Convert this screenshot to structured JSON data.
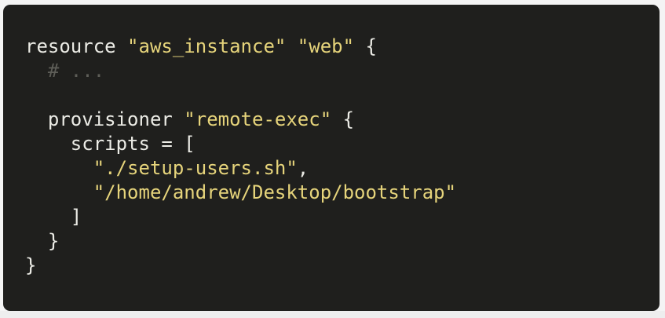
{
  "code_block": {
    "lines": [
      [
        {
          "text": "resource ",
          "kind": "plain"
        },
        {
          "text": "\"aws_instance\"",
          "kind": "string"
        },
        {
          "text": " ",
          "kind": "plain"
        },
        {
          "text": "\"web\"",
          "kind": "string"
        },
        {
          "text": " {",
          "kind": "plain"
        }
      ],
      [
        {
          "text": "  # ...",
          "kind": "comment"
        }
      ],
      [],
      [
        {
          "text": "  provisioner ",
          "kind": "plain"
        },
        {
          "text": "\"remote-exec\"",
          "kind": "string"
        },
        {
          "text": " {",
          "kind": "plain"
        }
      ],
      [
        {
          "text": "    scripts = [",
          "kind": "plain"
        }
      ],
      [
        {
          "text": "      ",
          "kind": "plain"
        },
        {
          "text": "\"./setup-users.sh\"",
          "kind": "string"
        },
        {
          "text": ",",
          "kind": "plain"
        }
      ],
      [
        {
          "text": "      ",
          "kind": "plain"
        },
        {
          "text": "\"/home/andrew/Desktop/bootstrap\"",
          "kind": "string"
        }
      ],
      [
        {
          "text": "    ]",
          "kind": "plain"
        }
      ],
      [
        {
          "text": "  }",
          "kind": "plain"
        }
      ],
      [
        {
          "text": "}",
          "kind": "plain"
        }
      ]
    ],
    "colors": {
      "background": "#1f1f1d",
      "plain": "#ecece6",
      "string": "#e6d47b",
      "comment": "#5e5e58"
    }
  }
}
